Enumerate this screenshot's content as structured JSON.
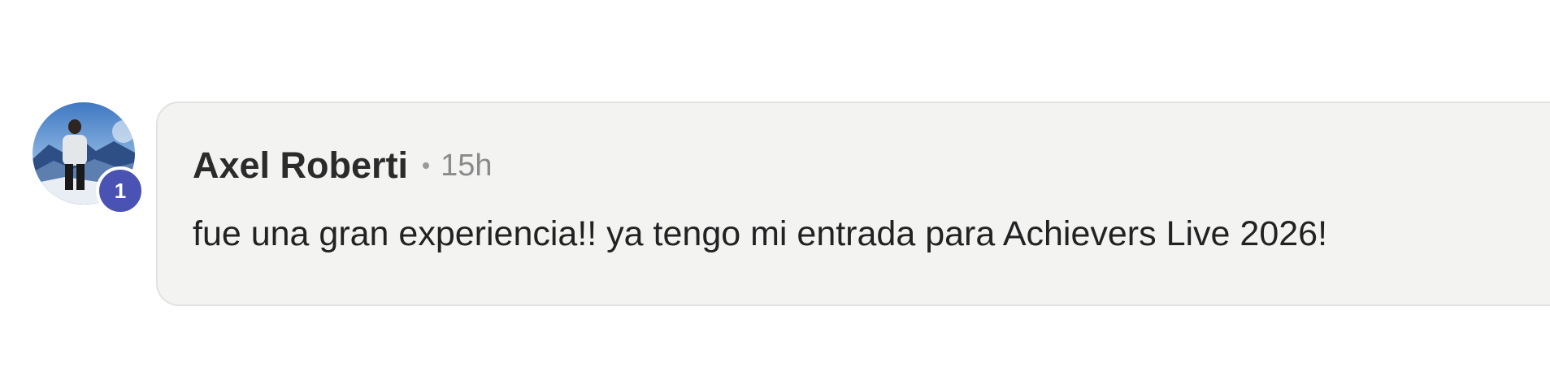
{
  "comment": {
    "author": "Axel Roberti",
    "timestamp": "15h",
    "text": "fue una gran experiencia!! ya tengo mi entrada para Achievers Live 2026!",
    "badge_count": "1",
    "avatar_icon": "profile-photo-mountain-person"
  },
  "colors": {
    "badge": "#4a52b3",
    "bubble_background": "#f3f3f2",
    "bubble_border": "#e2e2e1",
    "author_text": "#2b2b2b",
    "timestamp_text": "#8a8a8a",
    "body_text": "#222222"
  }
}
